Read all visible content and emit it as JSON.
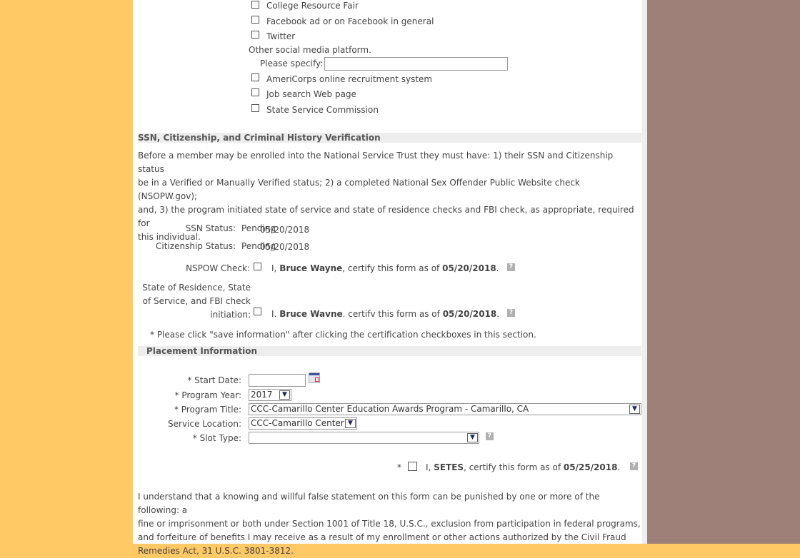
{
  "referral_sources": {
    "options": [
      {
        "label": "College Resource Fair",
        "checked": false
      },
      {
        "label": "Facebook ad or on Facebook in general",
        "checked": false
      },
      {
        "label": "Twitter",
        "checked": false
      }
    ],
    "other_social_label": "Other social media platform.",
    "please_specify_label": "Please specify:",
    "please_specify_value": "",
    "options_after": [
      {
        "label": "AmeriCorps online recruitment system",
        "checked": false
      },
      {
        "label": "Job search Web page",
        "checked": false
      },
      {
        "label": "State Service Commission",
        "checked": false
      }
    ]
  },
  "verification": {
    "heading": "SSN, Citizenship,  and Criminal History Verification",
    "intro_lines": [
      "Before a member may be enrolled into the National Service Trust they must have: 1) their SSN and Citizenship status",
      "be in a Verified or Manually Verified status; 2) a completed National Sex Offender Public Website check (NSOPW.gov);",
      "and, 3) the program initiated state of service and state of residence checks and FBI check, as appropriate, required for",
      "this individual."
    ],
    "ssn_label": "SSN Status:",
    "ssn_status": "Pending",
    "ssn_date": "05/20/2018",
    "citizenship_label": "Citizenship Status:",
    "citizenship_status": "Pending",
    "citizenship_date": "05/20/2018",
    "nspow_label": "NSPOW Check:",
    "cert_prefix": "I,",
    "cert_name": "Bruce Wayne",
    "cert_middle": ", certify this form as of",
    "cert_date": "05/20/2018",
    "cert_end": ".",
    "residence_label_lines": [
      "State of Residence, State",
      "of Service, and FBI check",
      "initiation:"
    ],
    "cert2_prefix": "I.",
    "cert2_name": "Bruce Wavne",
    "cert2_middle": ". certifv this form as of",
    "cert2_date": "05/20/2018",
    "note": "* Please click \"save information\" after clicking the certification checkboxes in this section.",
    "help_icon": "?"
  },
  "placement": {
    "heading": "Placement Information",
    "start_date_label": "* Start Date:",
    "start_date_value": "",
    "program_year_label": "* Program Year:",
    "program_year_value": "2017",
    "program_title_label": "* Program Title:",
    "program_title_value": "CCC-Camarillo Center Education Awards Program - Camarillo, CA",
    "service_location_label": "Service Location:",
    "service_location_value": "CCC-Camarillo Center",
    "slot_type_label": "* Slot Type:",
    "slot_type_value": "",
    "dropdown_arrow": "▼"
  },
  "certification": {
    "asterisk": "*",
    "prefix": "I,",
    "name": "SETES",
    "middle": ", certify this form as of",
    "date": "05/25/2018",
    "end": "."
  },
  "disclaimer_lines": [
    "I understand that a knowing and willful false statement on this form can be punished by one or more of the following: a",
    "fine or imprisonment or both under Section 1001 of Title 18, U.S.C., exclusion from participation in federal programs,",
    "and forfeiture of benefits I may receive as a result of my enrollment or other actions authorized by the Civil Fraud",
    "Remedies Act, 31 U.S.C. 3801-3812."
  ],
  "colors": {
    "left_background": "#FFC966",
    "right_background": "#9E8078",
    "section_header_bg": "#EDEDED"
  }
}
